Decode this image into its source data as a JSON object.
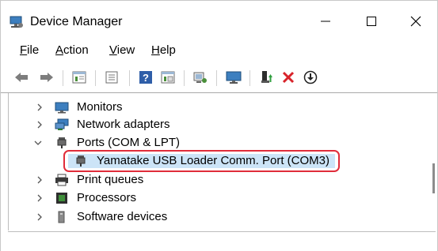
{
  "window": {
    "title": "Device Manager",
    "minimize": "—",
    "maximize": "☐",
    "close": "✕"
  },
  "menu": [
    {
      "label": "File",
      "accel": "F",
      "rest": "ile"
    },
    {
      "label": "Action",
      "accel": "A",
      "rest": "ction"
    },
    {
      "label": "View",
      "accel": "V",
      "rest": "iew"
    },
    {
      "label": "Help",
      "accel": "H",
      "rest": "elp"
    }
  ],
  "toolbar": {
    "icons": [
      "back-arrow-icon",
      "forward-arrow-icon",
      "properties-sheet-icon",
      "device-list-icon",
      "help-icon",
      "action-pane-icon",
      "scan-hardware-icon",
      "monitor-icon",
      "update-driver-icon",
      "uninstall-icon",
      "download-icon"
    ]
  },
  "tree": {
    "items": [
      {
        "label": "Monitors",
        "expanded": false
      },
      {
        "label": "Network adapters",
        "expanded": false
      },
      {
        "label": "Ports (COM & LPT)",
        "expanded": true
      },
      {
        "label": "Yamatake USB Loader Comm. Port (COM3)",
        "child": true,
        "selected": true
      },
      {
        "label": "Print queues",
        "expanded": false
      },
      {
        "label": "Processors",
        "expanded": false
      },
      {
        "label": "Software devices",
        "expanded": false
      }
    ]
  },
  "colors": {
    "selection": "#cce4f7",
    "highlight_border": "#e02c3a",
    "title_text": "#000000"
  }
}
